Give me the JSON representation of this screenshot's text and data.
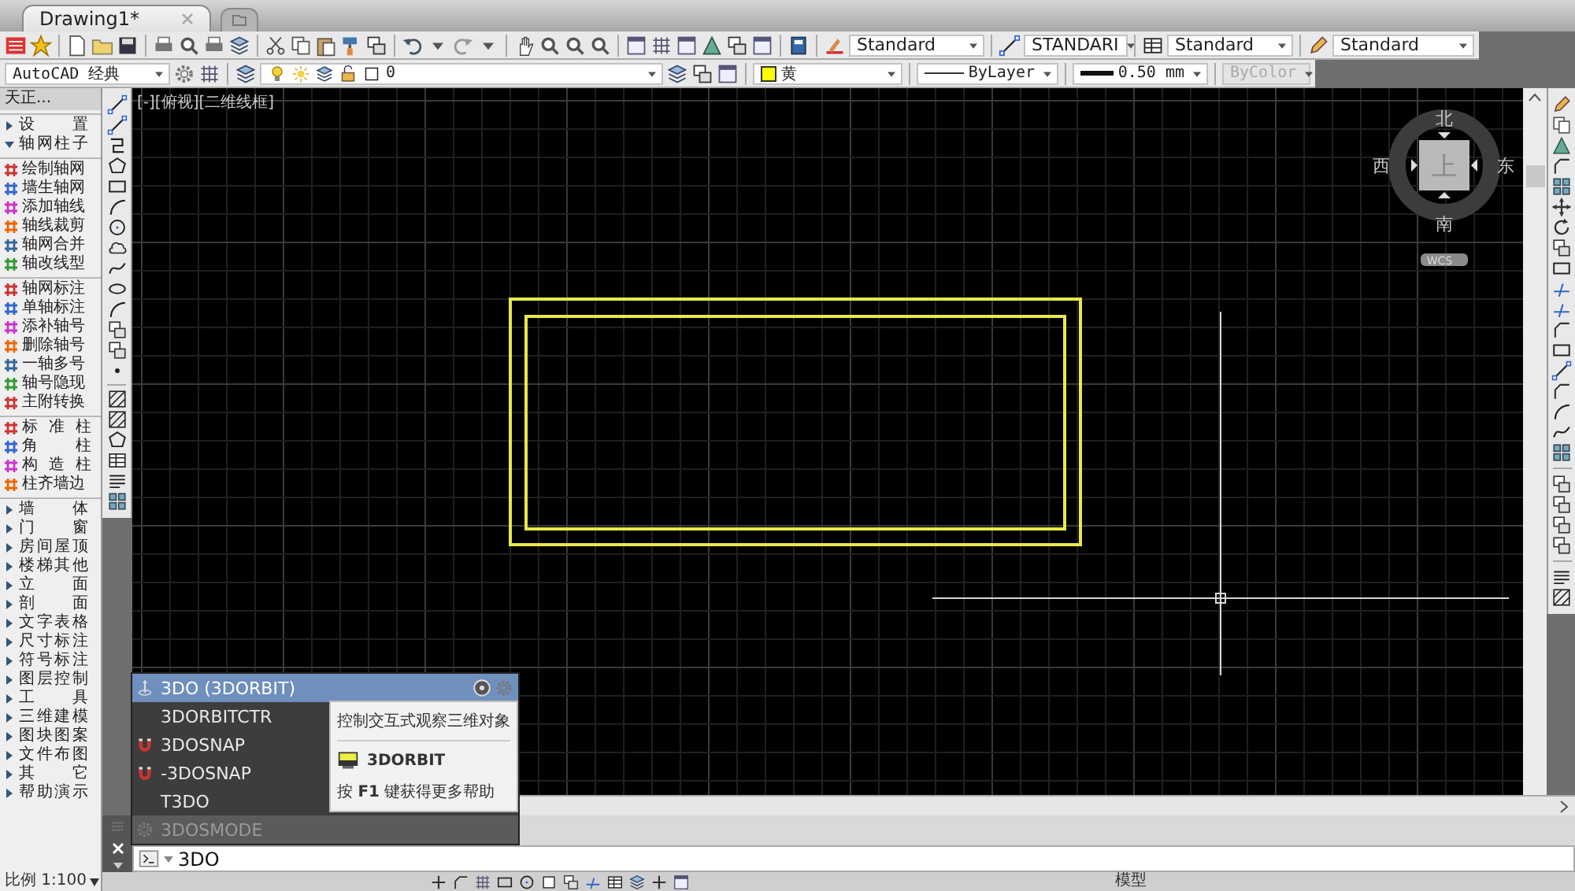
{
  "tabs": [
    {
      "label": "Drawing1*",
      "selected": true
    }
  ],
  "style_toolbar": [
    {
      "kind": "text",
      "value": "Standard"
    },
    {
      "kind": "dimension",
      "value": "STANDARI"
    },
    {
      "kind": "table",
      "value": "Standard"
    },
    {
      "kind": "multileader",
      "value": "Standard"
    }
  ],
  "properties_bar": {
    "workspace": "AutoCAD 经典",
    "layer": "0",
    "color": {
      "label": "黄",
      "color": "#ffff00"
    },
    "linetype": "ByLayer",
    "lineweight": "0.50 mm",
    "plot_style": {
      "value": "ByColor",
      "disabled": true
    }
  },
  "tianzheng_menu": {
    "title": "天正...",
    "items": [
      {
        "kind": "folder",
        "label": "设 置",
        "expanded": false
      },
      {
        "kind": "folder",
        "label": "轴网柱子",
        "expanded": true,
        "groups": [
          [
            "绘制轴网",
            "墙生轴网",
            "添加轴线",
            "轴线裁剪",
            "轴网合并",
            "轴改线型"
          ],
          [
            "轴网标注",
            "单轴标注",
            "添补轴号",
            "删除轴号",
            "一轴多号",
            "轴号隐现",
            "主附转换"
          ],
          [
            "标 准 柱",
            "角 柱",
            "构 造 柱",
            "柱齐墙边"
          ]
        ]
      },
      {
        "kind": "folder",
        "label": "墙 体",
        "expanded": false
      },
      {
        "kind": "folder",
        "label": "门 窗",
        "expanded": false
      },
      {
        "kind": "folder",
        "label": "房间屋顶",
        "expanded": false
      },
      {
        "kind": "folder",
        "label": "楼梯其他",
        "expanded": false
      },
      {
        "kind": "folder",
        "label": "立 面",
        "expanded": false
      },
      {
        "kind": "folder",
        "label": "剖 面",
        "expanded": false
      },
      {
        "kind": "folder",
        "label": "文字表格",
        "expanded": false
      },
      {
        "kind": "folder",
        "label": "尺寸标注",
        "expanded": false
      },
      {
        "kind": "folder",
        "label": "符号标注",
        "expanded": false
      },
      {
        "kind": "folder",
        "label": "图层控制",
        "expanded": false
      },
      {
        "kind": "folder",
        "label": "工 具",
        "expanded": false
      },
      {
        "kind": "folder",
        "label": "三维建模",
        "expanded": false
      },
      {
        "kind": "folder",
        "label": "图块图案",
        "expanded": false
      },
      {
        "kind": "folder",
        "label": "文件布图",
        "expanded": false
      },
      {
        "kind": "folder",
        "label": "其 它",
        "expanded": false
      },
      {
        "kind": "folder",
        "label": "帮助演示",
        "expanded": false
      }
    ]
  },
  "viewport": {
    "label": "[-][俯视][二维线框]",
    "viewcube": {
      "face": "上",
      "north": "北",
      "south": "南",
      "west": "西",
      "east": "东",
      "ucs": "WCS"
    }
  },
  "autocomplete": {
    "items": [
      {
        "kind": "orbit",
        "label": "3DO (3DORBIT)",
        "selected": true,
        "disabled": false
      },
      {
        "kind": "plain",
        "label": "3DORBITCTR",
        "selected": false,
        "disabled": false
      },
      {
        "kind": "snap",
        "label": "3DOSNAP",
        "selected": false,
        "disabled": false
      },
      {
        "kind": "snap",
        "label": "-3DOSNAP",
        "selected": false,
        "disabled": false
      },
      {
        "kind": "plain",
        "label": "T3DO",
        "selected": false,
        "disabled": false
      },
      {
        "kind": "setting",
        "label": "3DOSMODE",
        "selected": false,
        "disabled": true
      }
    ],
    "tooltip": {
      "description": "控制交互式观察三维对象",
      "command": "3DORBIT",
      "help": "按 **F1** 键获得更多帮助"
    }
  },
  "command_line": {
    "value": "3DO"
  },
  "status_bar": {
    "scale": "比例 1:100",
    "space": "模型"
  }
}
